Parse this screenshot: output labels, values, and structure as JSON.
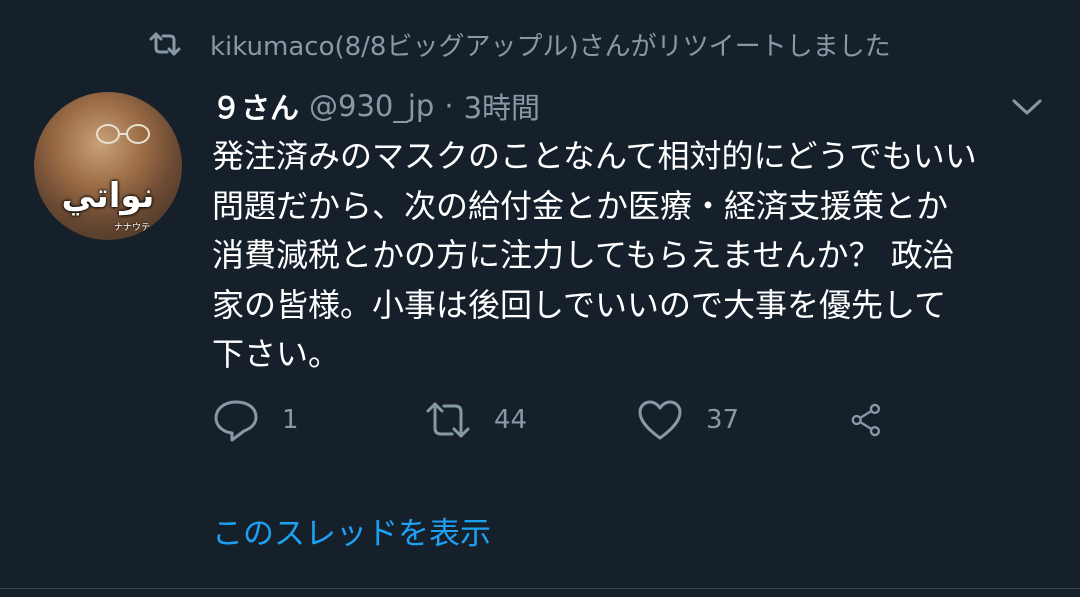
{
  "retweet": {
    "icon": "retweet-icon",
    "text": "kikumaco(8/8ビッグアップル)さんがリツイートしました"
  },
  "tweet": {
    "author_name": "９さん",
    "author_handle": "@930_jp",
    "separator": "·",
    "time": "3時間",
    "avatar_caption": "نواتي",
    "avatar_small_text": "ナナウテ",
    "text": "発注済みのマスクのことなんて相対的にどうでもいい\n問題だから、次の給付金とか医療・経済支援策とか\n消費減税とかの方に注力してもらえませんか？ 政治\n家の皆様。小事は後回しでいいので大事を優先して\n下さい。"
  },
  "actions": {
    "reply_count": "1",
    "retweet_count": "44",
    "like_count": "37"
  },
  "thread_link": "このスレッドを表示",
  "colors": {
    "background": "#15202b",
    "secondary_text": "#8899a6",
    "link": "#1da1f2",
    "divider": "#38444d"
  }
}
